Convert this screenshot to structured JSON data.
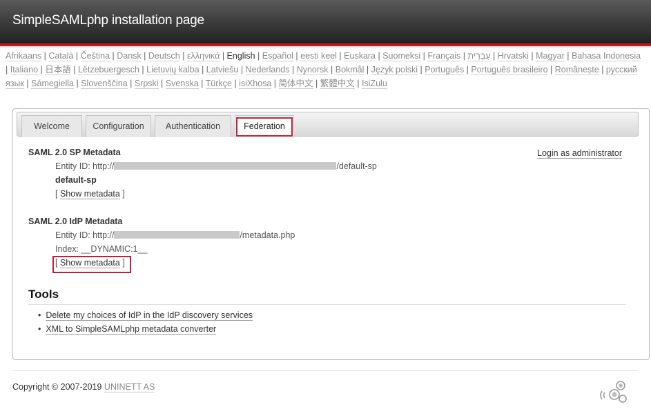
{
  "header": {
    "title": "SimpleSAMLphp installation page"
  },
  "languages": {
    "current": "English",
    "items": [
      "Afrikaans",
      "Català",
      "Čeština",
      "Dansk",
      "Deutsch",
      "ελληνικά",
      "English",
      "Español",
      "eesti keel",
      "Euskara",
      "Suomeksi",
      "Français",
      "עִבְרִית",
      "Hrvatski",
      "Magyar",
      "Bahasa Indonesia",
      "Italiano",
      "日本語",
      "Lëtzebuergesch",
      "Lietuvių kalba",
      "Latviešu",
      "Nederlands",
      "Nynorsk",
      "Bokmål",
      "Język polski",
      "Português",
      "Português brasileiro",
      "Românește",
      "русский язык",
      "Sámegiella",
      "Slovenščina",
      "Srpski",
      "Svenska",
      "Türkçe",
      "isiXhosa",
      "简体中文",
      "繁體中文",
      "IsiZulu"
    ]
  },
  "tabs": [
    {
      "label": "Welcome"
    },
    {
      "label": "Configuration"
    },
    {
      "label": "Authentication"
    },
    {
      "label": "Federation"
    }
  ],
  "login_link": "Login as administrator",
  "sp": {
    "title": "SAML 2.0 SP Metadata",
    "entity_prefix": "Entity ID: http://",
    "entity_suffix": "/default-sp",
    "name": "default-sp",
    "show_metadata": "Show metadata",
    "bracket_open": "[",
    "bracket_close": "]"
  },
  "idp": {
    "title": "SAML 2.0 IdP Metadata",
    "entity_prefix": "Entity ID: http://",
    "entity_suffix": "/metadata.php",
    "index": "Index:  __DYNAMIC:1__",
    "show_metadata": "Show metadata",
    "bracket_open": "[",
    "bracket_close": "]"
  },
  "tools": {
    "title": "Tools",
    "items": [
      "Delete my choices of IdP in the IdP discovery services",
      "XML to SimpleSAMLphp metadata converter"
    ]
  },
  "footer": {
    "copyright": "Copyright © 2007-2019",
    "org": "UNINETT AS"
  },
  "colors": {
    "accent_red": "#c4161c",
    "highlight": "#c42030"
  }
}
